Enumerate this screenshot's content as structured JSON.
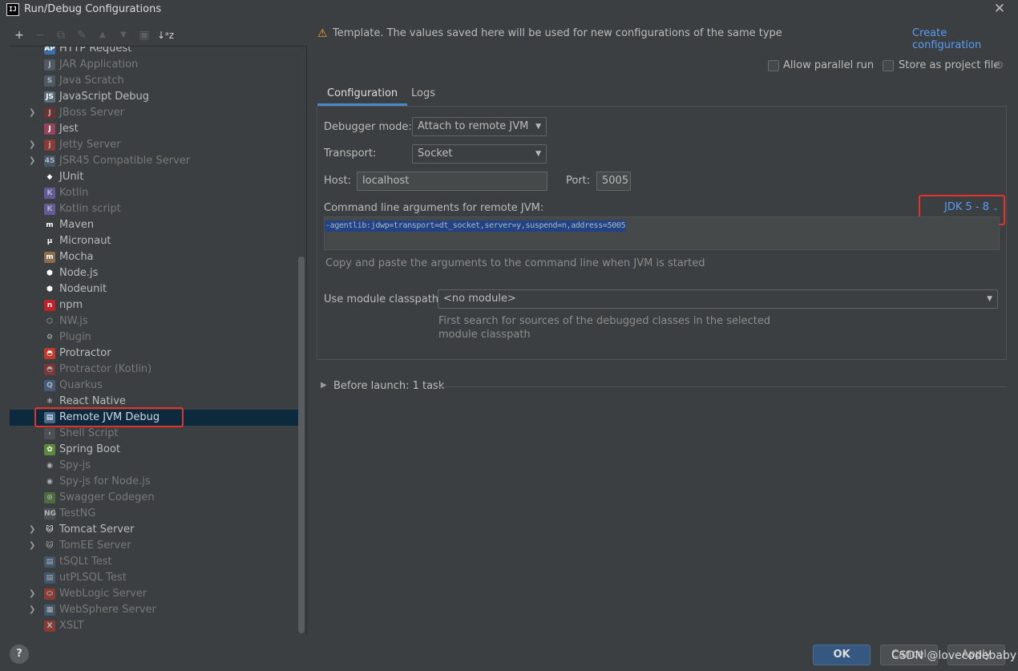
{
  "window": {
    "title": "Run/Debug Configurations",
    "app_logo": "IJ"
  },
  "toolbar": {
    "add": "+",
    "remove": "−",
    "copy": "⧉",
    "edit": "🔧",
    "move_up": "▲",
    "move_down": "▼",
    "folder": "▣",
    "sort": "↓ª"
  },
  "tree": {
    "items": [
      {
        "label": "HTTP Request",
        "icon": "api-icon",
        "glyph": "AP",
        "color": "#3d6ea8",
        "enabled": true,
        "expandable": false
      },
      {
        "label": "JAR Application",
        "icon": "jar-icon",
        "glyph": "J",
        "color": "#5a6b7a",
        "enabled": false,
        "expandable": false
      },
      {
        "label": "Java Scratch",
        "icon": "java-scratch-icon",
        "glyph": "S",
        "color": "#5a6b7a",
        "enabled": false,
        "expandable": false
      },
      {
        "label": "JavaScript Debug",
        "icon": "javascript-debug-icon",
        "glyph": "JS",
        "color": "#5a6b7a",
        "enabled": true,
        "expandable": false
      },
      {
        "label": "JBoss Server",
        "icon": "jboss-icon",
        "glyph": "J",
        "color": "#8a2b2b",
        "enabled": false,
        "expandable": true
      },
      {
        "label": "Jest",
        "icon": "jest-icon",
        "glyph": "J",
        "color": "#99425b",
        "enabled": true,
        "expandable": false
      },
      {
        "label": "Jetty Server",
        "icon": "jetty-icon",
        "glyph": "j",
        "color": "#c0392b",
        "enabled": false,
        "expandable": true
      },
      {
        "label": "JSR45 Compatible Server",
        "icon": "jsr45-icon",
        "glyph": "45",
        "color": "#4a6a8a",
        "enabled": false,
        "expandable": true
      },
      {
        "label": "JUnit",
        "icon": "junit-icon",
        "glyph": "◆",
        "color": "#3c3f41",
        "enabled": true,
        "expandable": false
      },
      {
        "label": "Kotlin",
        "icon": "kotlin-icon",
        "glyph": "K",
        "color": "#7f6bd8",
        "enabled": false,
        "expandable": false
      },
      {
        "label": "Kotlin script",
        "icon": "kotlin-script-icon",
        "glyph": "K",
        "color": "#7f6bd8",
        "enabled": false,
        "expandable": false
      },
      {
        "label": "Maven",
        "icon": "maven-icon",
        "glyph": "m",
        "color": "#3c3f41",
        "enabled": true,
        "expandable": false
      },
      {
        "label": "Micronaut",
        "icon": "micronaut-icon",
        "glyph": "μ",
        "color": "#3c3f41",
        "enabled": true,
        "expandable": false
      },
      {
        "label": "Mocha",
        "icon": "mocha-icon",
        "glyph": "m",
        "color": "#8d6e4a",
        "enabled": true,
        "expandable": false
      },
      {
        "label": "Node.js",
        "icon": "nodejs-icon",
        "glyph": "⬢",
        "color": "#3c3f41",
        "enabled": true,
        "expandable": false
      },
      {
        "label": "Nodeunit",
        "icon": "nodeunit-icon",
        "glyph": "⬢",
        "color": "#3c3f41",
        "enabled": true,
        "expandable": false
      },
      {
        "label": "npm",
        "icon": "npm-icon",
        "glyph": "n",
        "color": "#c12127",
        "enabled": true,
        "expandable": false
      },
      {
        "label": "NW.js",
        "icon": "nwjs-icon",
        "glyph": "⬡",
        "color": "#3c3f41",
        "enabled": false,
        "expandable": false
      },
      {
        "label": "Plugin",
        "icon": "plugin-icon",
        "glyph": "⚙",
        "color": "#3c3f41",
        "enabled": false,
        "expandable": false
      },
      {
        "label": "Protractor",
        "icon": "protractor-icon",
        "glyph": "◓",
        "color": "#c0392b",
        "enabled": true,
        "expandable": false
      },
      {
        "label": "Protractor (Kotlin)",
        "icon": "protractor-kotlin-icon",
        "glyph": "◓",
        "color": "#a33",
        "enabled": false,
        "expandable": false
      },
      {
        "label": "Quarkus",
        "icon": "quarkus-icon",
        "glyph": "Q",
        "color": "#4a6fa5",
        "enabled": false,
        "expandable": false
      },
      {
        "label": "React Native",
        "icon": "react-native-icon",
        "glyph": "⚛",
        "color": "#3c3f41",
        "enabled": true,
        "expandable": false
      },
      {
        "label": "Remote JVM Debug",
        "icon": "remote-debug-icon",
        "glyph": "▤",
        "color": "#4a6a8a",
        "enabled": true,
        "expandable": false,
        "selected": true
      },
      {
        "label": "Shell Script",
        "icon": "shell-script-icon",
        "glyph": "›",
        "color": "#5a5d5f",
        "enabled": false,
        "expandable": false
      },
      {
        "label": "Spring Boot",
        "icon": "spring-boot-icon",
        "glyph": "✿",
        "color": "#5a8a3a",
        "enabled": true,
        "expandable": false
      },
      {
        "label": "Spy-js",
        "icon": "spy-js-icon",
        "glyph": "◉",
        "color": "#3c3f41",
        "enabled": false,
        "expandable": false
      },
      {
        "label": "Spy-js for Node.js",
        "icon": "spy-js-node-icon",
        "glyph": "◉",
        "color": "#3c3f41",
        "enabled": false,
        "expandable": false
      },
      {
        "label": "Swagger Codegen",
        "icon": "swagger-icon",
        "glyph": "⊙",
        "color": "#5a8a3a",
        "enabled": false,
        "expandable": false
      },
      {
        "label": "TestNG",
        "icon": "testng-icon",
        "glyph": "NG",
        "color": "#5a5d5f",
        "enabled": false,
        "expandable": false
      },
      {
        "label": "Tomcat Server",
        "icon": "tomcat-icon",
        "glyph": "🐱",
        "color": "#3c3f41",
        "enabled": true,
        "expandable": true
      },
      {
        "label": "TomEE Server",
        "icon": "tomee-icon",
        "glyph": "🐱",
        "color": "#3c3f41",
        "enabled": false,
        "expandable": true
      },
      {
        "label": "tSQLt Test",
        "icon": "tsqlt-icon",
        "glyph": "▤",
        "color": "#4a6a8a",
        "enabled": false,
        "expandable": false
      },
      {
        "label": "utPLSQL Test",
        "icon": "utplsql-icon",
        "glyph": "▤",
        "color": "#4a6a8a",
        "enabled": false,
        "expandable": false
      },
      {
        "label": "WebLogic Server",
        "icon": "weblogic-icon",
        "glyph": "⬭",
        "color": "#c0392b",
        "enabled": false,
        "expandable": true
      },
      {
        "label": "WebSphere Server",
        "icon": "websphere-icon",
        "glyph": "▦",
        "color": "#4a6a8a",
        "enabled": false,
        "expandable": true
      },
      {
        "label": "XSLT",
        "icon": "xslt-icon",
        "glyph": "X",
        "color": "#c0392b",
        "enabled": false,
        "expandable": false
      }
    ]
  },
  "header": {
    "template_notice": "Template. The values saved here will be used for new configurations of the same type",
    "create_link": "Create configuration",
    "allow_parallel": "Allow parallel run",
    "store_as_file": "Store as project file"
  },
  "tabs": [
    {
      "label": "Configuration"
    },
    {
      "label": "Logs"
    }
  ],
  "config": {
    "debugger_mode_label": "Debugger mode:",
    "debugger_mode_value": "Attach to remote JVM",
    "transport_label": "Transport:",
    "transport_value": "Socket",
    "host_label": "Host:",
    "host_value": "localhost",
    "port_label": "Port:",
    "port_value": "5005",
    "cmd_label": "Command line arguments for remote JVM:",
    "jdk_selector": "JDK 5 - 8",
    "cmd_args": "-agentlib:jdwp=transport=dt_socket,server=y,suspend=n,address=5005",
    "cmd_hint": "Copy and paste the arguments to the command line when JVM is started",
    "module_label": "Use module classpath:",
    "module_value": "<no module>",
    "module_hint_1": "First search for sources of the debugged classes in the selected",
    "module_hint_2": "module classpath"
  },
  "before_launch": "Before launch: 1 task",
  "buttons": {
    "ok": "OK",
    "cancel": "Cancel",
    "apply": "Apply",
    "help": "?"
  },
  "watermark": "CSDN @lovecodebaby",
  "colors": {
    "accent": "#589df6",
    "highlight_box": "#e5322d",
    "selection": "#0d293e",
    "primary_button": "#365880"
  }
}
